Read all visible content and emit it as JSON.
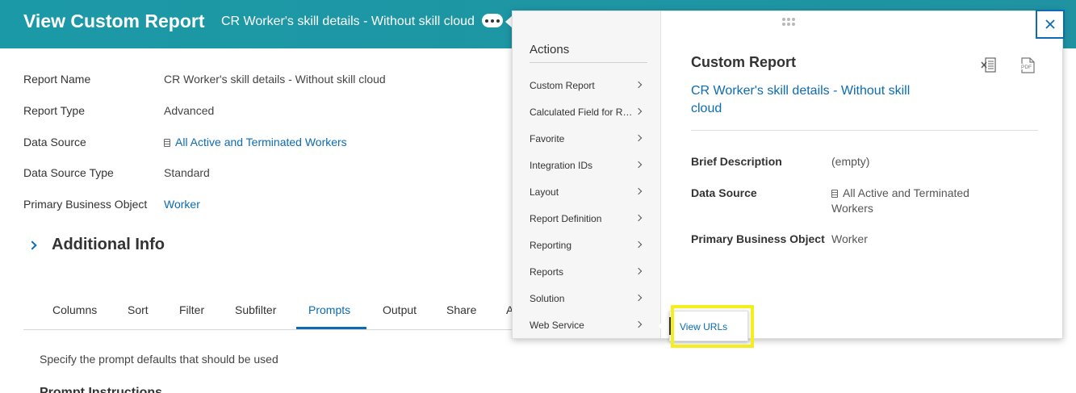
{
  "header": {
    "title": "View Custom Report",
    "subtitle": "CR Worker's skill details - Without skill cloud",
    "related_actions_icon": "more-horizontal-icon"
  },
  "fields": [
    {
      "label": "Report Name",
      "value": "CR Worker's skill details - Without skill cloud",
      "is_link": false
    },
    {
      "label": "Report Type",
      "value": "Advanced",
      "is_link": false
    },
    {
      "label": "Data Source",
      "value": "All Active and Terminated Workers",
      "is_link": true
    },
    {
      "label": "Data Source Type",
      "value": "Standard",
      "is_link": false
    },
    {
      "label": "Primary Business Object",
      "value": "Worker",
      "is_link": true
    }
  ],
  "additional_info": {
    "title": "Additional Info"
  },
  "tabs": [
    "Columns",
    "Sort",
    "Filter",
    "Subfilter",
    "Prompts",
    "Output",
    "Share",
    "A"
  ],
  "active_tab": "Prompts",
  "prompts": {
    "description": "Specify the prompt defaults that should be used",
    "heading": "Prompt Instructions"
  },
  "popup": {
    "actions_title": "Actions",
    "actions": [
      "Custom Report",
      "Calculated Field for Report",
      "Favorite",
      "Integration IDs",
      "Layout",
      "Report Definition",
      "Reporting",
      "Reports",
      "Solution",
      "Web Service"
    ],
    "detail": {
      "title": "Custom Report",
      "link": "CR Worker's skill details - Without skill cloud",
      "brief_description_label": "Brief Description",
      "brief_description_value": "(empty)",
      "data_source_label": "Data Source",
      "data_source_value": "All Active and Terminated Workers",
      "primary_bo_label": "Primary Business Object",
      "primary_bo_value": "Worker"
    },
    "submenu_item": "View URLs"
  },
  "colors": {
    "header_bg": "#1c99a6",
    "link": "#0b6bb5",
    "highlight": "#f4ee1c"
  }
}
